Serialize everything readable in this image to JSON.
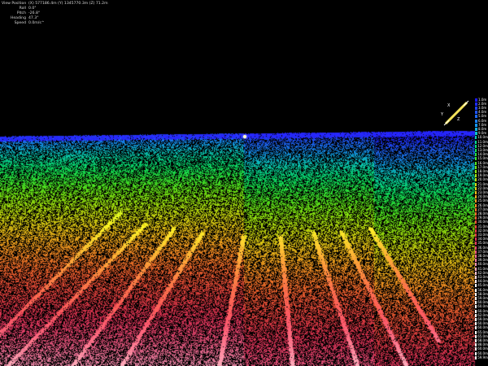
{
  "hud": {
    "rows": [
      {
        "label": "View Position",
        "value": "(X) 577186.4m (Y) 1345770.3m (Z) 71.2m"
      },
      {
        "label": "Roll",
        "value": "0.0°"
      },
      {
        "label": "Pitch",
        "value": "-26.8°"
      },
      {
        "label": "Heading",
        "value": "47.3°"
      },
      {
        "label": "Speed",
        "value": "0.0m/s^"
      }
    ]
  },
  "gizmo": {
    "axes": [
      "X",
      "Y",
      "Z"
    ],
    "color": "#f3e25b"
  },
  "legend": {
    "entries": [
      {
        "label": "1.0m",
        "color": "#1a18ff"
      },
      {
        "label": "2.0m",
        "color": "#1d2cff"
      },
      {
        "label": "3.0m",
        "color": "#1f40ff"
      },
      {
        "label": "4.0m",
        "color": "#1f55ff"
      },
      {
        "label": "5.0m",
        "color": "#1e6aff"
      },
      {
        "label": "6.0m",
        "color": "#1a80ff"
      },
      {
        "label": "7.0m",
        "color": "#1596f4"
      },
      {
        "label": "8.0m",
        "color": "#10aee0"
      },
      {
        "label": "9.0m",
        "color": "#0cc2c6"
      },
      {
        "label": "10.0m",
        "color": "#0ad0aa"
      },
      {
        "label": "11.0m",
        "color": "#08da8c"
      },
      {
        "label": "12.0m",
        "color": "#0ae070"
      },
      {
        "label": "13.0m",
        "color": "#14e456"
      },
      {
        "label": "14.0m",
        "color": "#26e640"
      },
      {
        "label": "15.0m",
        "color": "#3ce82c"
      },
      {
        "label": "16.0m",
        "color": "#56ea1e"
      },
      {
        "label": "17.0m",
        "color": "#72ea14"
      },
      {
        "label": "18.0m",
        "color": "#8eea10"
      },
      {
        "label": "19.0m",
        "color": "#a8e60e"
      },
      {
        "label": "20.0m",
        "color": "#c0e00e"
      },
      {
        "label": "21.0m",
        "color": "#d4d810"
      },
      {
        "label": "22.0m",
        "color": "#e4cc14"
      },
      {
        "label": "23.0m",
        "color": "#f0be18"
      },
      {
        "label": "24.0m",
        "color": "#f6ae1c"
      },
      {
        "label": "25.0m",
        "color": "#f89c20"
      },
      {
        "label": "26.0m",
        "color": "#f88a24"
      },
      {
        "label": "27.0m",
        "color": "#f67828"
      },
      {
        "label": "28.0m",
        "color": "#f4682c"
      },
      {
        "label": "29.0m",
        "color": "#f05a32"
      },
      {
        "label": "30.0m",
        "color": "#ec4e38"
      },
      {
        "label": "31.0m",
        "color": "#e8443e"
      },
      {
        "label": "32.0m",
        "color": "#e43c44"
      },
      {
        "label": "33.0m",
        "color": "#e0364c"
      },
      {
        "label": "34.0m",
        "color": "#e23456"
      },
      {
        "label": "35.0m",
        "color": "#e63a62"
      },
      {
        "label": "36.0m",
        "color": "#ea4670"
      },
      {
        "label": "37.0m",
        "color": "#ee5680"
      },
      {
        "label": "38.0m",
        "color": "#f26a92"
      },
      {
        "label": "39.0m",
        "color": "#f480a4"
      },
      {
        "label": "40.0m",
        "color": "#f696b6"
      },
      {
        "label": "41.0m",
        "color": "#f8acc6"
      },
      {
        "label": "42.0m",
        "color": "#fac4d6"
      },
      {
        "label": "43.0m",
        "color": "#fcdae6"
      },
      {
        "label": "44.0m",
        "color": "#fdecf2"
      },
      {
        "label": "45.0m",
        "color": "#ffffff"
      },
      {
        "label": "56.0m",
        "color": "#ffffff"
      },
      {
        "label": "58.0m",
        "color": "#ffffff"
      },
      {
        "label": "59.0m",
        "color": "#ffffff"
      },
      {
        "label": "60.0m",
        "color": "#ffffff"
      },
      {
        "label": "60.0m",
        "color": "#ffffff"
      },
      {
        "label": "60.0m",
        "color": "#ffffff"
      },
      {
        "label": "62.0m",
        "color": "#ffffff"
      },
      {
        "label": "69.0m",
        "color": "#ffffff"
      },
      {
        "label": "60.0m",
        "color": "#ffffff"
      },
      {
        "label": "60.0m",
        "color": "#ffffff"
      },
      {
        "label": "65.0m",
        "color": "#ffffff"
      },
      {
        "label": "65.0m",
        "color": "#ffffff"
      },
      {
        "label": "68.0m",
        "color": "#ffffff"
      },
      {
        "label": "88.0m",
        "color": "#ffffff"
      },
      {
        "label": "60.0m",
        "color": "#ffffff"
      },
      {
        "label": "60.0m",
        "color": "#ffffff"
      },
      {
        "label": "59.9m",
        "color": "#ffffff"
      }
    ]
  },
  "scene": {
    "background": "#000000",
    "marker_color": "#fff8cf"
  }
}
